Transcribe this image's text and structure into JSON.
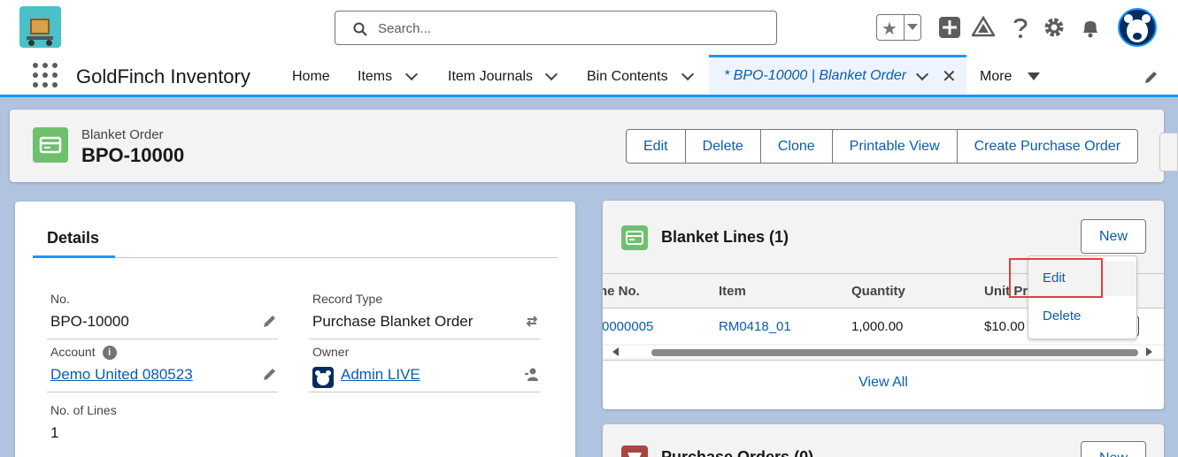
{
  "app": {
    "name": "GoldFinch Inventory",
    "search_placeholder": "Search..."
  },
  "nav": {
    "items": [
      {
        "label": "Home"
      },
      {
        "label": "Items"
      },
      {
        "label": "Item Journals"
      },
      {
        "label": "Bin Contents"
      }
    ],
    "active_tab": "* BPO-10000 | Blanket Order",
    "more_label": "More"
  },
  "record": {
    "object_label": "Blanket Order",
    "title": "BPO-10000",
    "actions": [
      "Edit",
      "Delete",
      "Clone",
      "Printable View",
      "Create Purchase Order"
    ]
  },
  "details": {
    "tab_label": "Details",
    "fields": {
      "no": {
        "label": "No.",
        "value": "BPO-10000"
      },
      "record_type": {
        "label": "Record Type",
        "value": "Purchase Blanket Order"
      },
      "account": {
        "label": "Account",
        "value": "Demo United 080523"
      },
      "owner": {
        "label": "Owner",
        "value": "Admin LIVE"
      },
      "no_of_lines": {
        "label": "No. of Lines",
        "value": "1"
      }
    }
  },
  "blanket_lines": {
    "title": "Blanket Lines (1)",
    "new_label": "New",
    "columns": [
      "ne No.",
      "Item",
      "Quantity",
      "Unit Pr"
    ],
    "rows": [
      {
        "line_no": "-0000005",
        "item": "RM0418_01",
        "quantity": "1,000.00",
        "unit_price": "$10.00"
      }
    ],
    "view_all": "View All",
    "row_menu": [
      "Edit",
      "Delete"
    ]
  },
  "purchase_orders": {
    "title": "Purchase Orders (0)",
    "new_label": "New"
  },
  "colors": {
    "brand_blue": "#1b96ff",
    "link_blue": "#0b5cab",
    "record_icon_green": "#6ec06e",
    "po_icon_red": "#a94442",
    "highlight_red": "#e0403a"
  }
}
